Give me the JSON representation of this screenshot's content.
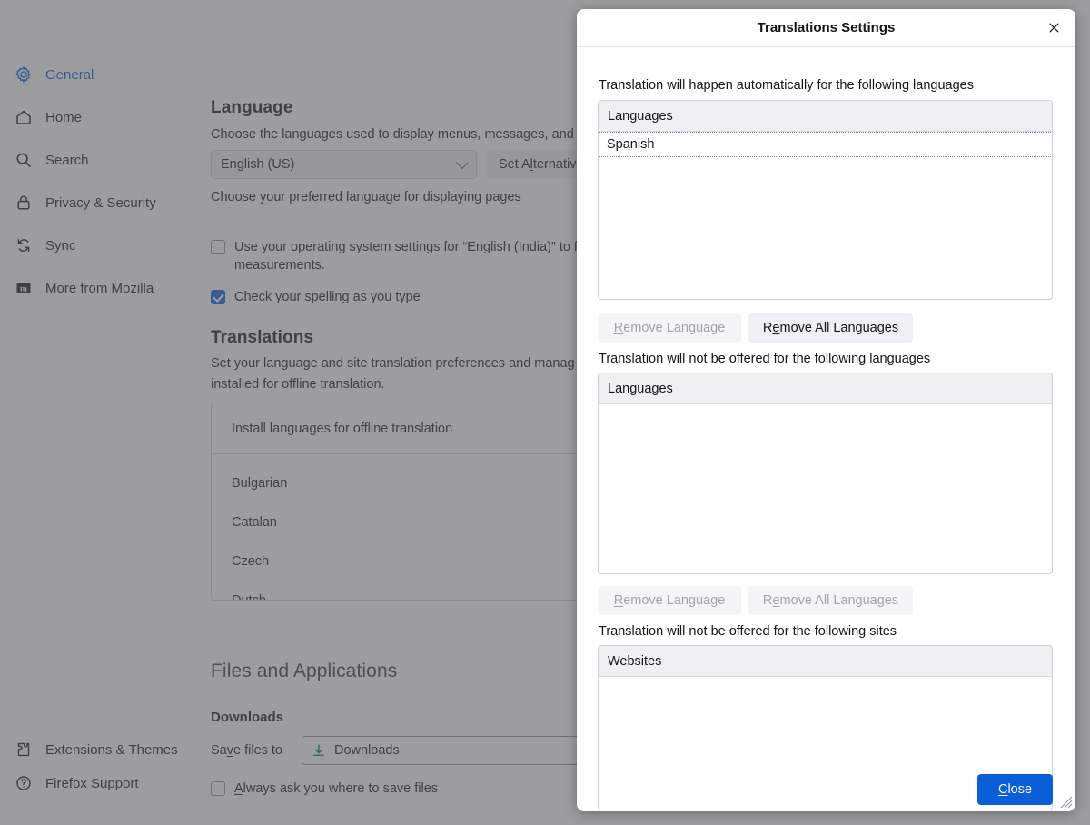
{
  "sidebar": {
    "items": [
      {
        "label": "General",
        "icon": "gear-icon",
        "active": true
      },
      {
        "label": "Home",
        "icon": "home-icon",
        "active": false
      },
      {
        "label": "Search",
        "icon": "search-icon",
        "active": false
      },
      {
        "label": "Privacy & Security",
        "icon": "lock-icon",
        "active": false
      },
      {
        "label": "Sync",
        "icon": "sync-icon",
        "active": false
      },
      {
        "label": "More from Mozilla",
        "icon": "mozilla-icon",
        "active": false
      }
    ],
    "footer": [
      {
        "label": "Extensions & Themes",
        "icon": "puzzle-icon"
      },
      {
        "label": "Firefox Support",
        "icon": "help-icon"
      }
    ]
  },
  "main": {
    "language": {
      "heading": "Language",
      "description": "Choose the languages used to display menus, messages, and n",
      "locale_value": "English (US)",
      "set_alternatives_label": "Set Alternativ",
      "preferred_text": "Choose your preferred language for displaying pages",
      "os_settings_line1": "Use your operating system settings for “English (India)” to f",
      "os_settings_line2": "measurements.",
      "os_settings_checked": false,
      "spellcheck_label": "Check your spelling as you type",
      "spellcheck_checked": true
    },
    "translations": {
      "heading": "Translations",
      "description_line1": "Set your language and site translation preferences and manag",
      "description_line2": "installed for offline translation.",
      "panel_header": "Install languages for offline translation",
      "rows": [
        "Bulgarian",
        "Catalan",
        "Czech",
        "Dutch"
      ]
    },
    "files": {
      "heading": "Files and Applications",
      "subheading": "Downloads",
      "save_files_label": "Save files to",
      "save_files_value": "Downloads",
      "save_files_icon": "download-icon",
      "always_ask_label": "Always ask you where to save files",
      "always_ask_checked": false
    }
  },
  "modal": {
    "title": "Translations Settings",
    "close_icon": "close-icon",
    "sections": [
      {
        "label": "Translation will happen automatically for the following languages",
        "column_header": "Languages",
        "items": [
          "Spanish"
        ],
        "focused_index": 0,
        "buttons": [
          {
            "label": "Remove Language",
            "accesskey": "R",
            "disabled": true
          },
          {
            "label": "Remove All Languages",
            "accesskey": "e",
            "disabled": false
          }
        ]
      },
      {
        "label": "Translation will not be offered for the following languages",
        "column_header": "Languages",
        "items": [],
        "focused_index": -1,
        "buttons": [
          {
            "label": "Remove Language",
            "accesskey": "R",
            "disabled": true
          },
          {
            "label": "Remove All Languages",
            "accesskey": "e",
            "disabled": true
          }
        ]
      },
      {
        "label": "Translation will not be offered for the following sites",
        "column_header": "Websites",
        "items": [],
        "focused_index": -1,
        "buttons": []
      }
    ],
    "close_button": {
      "label": "Close",
      "accesskey": "C"
    },
    "resize_grip": "resize-grip-icon"
  },
  "colors": {
    "accent": "#0060df",
    "primary_button": "#0a5fd9",
    "overlay": "rgba(92,92,97,0.60)",
    "panel_border": "#cfcfd8",
    "list_header_bg": "#f0f0f2"
  }
}
